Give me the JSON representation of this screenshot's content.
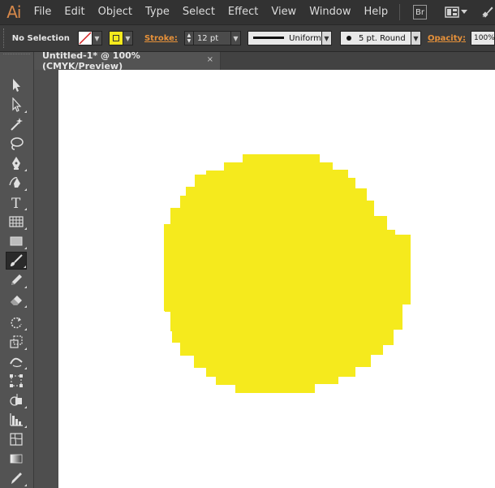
{
  "app": {
    "logo_text": "Ai",
    "menu": [
      "File",
      "Edit",
      "Object",
      "Type",
      "Select",
      "Effect",
      "View",
      "Window",
      "Help"
    ],
    "bridge_label": "Br"
  },
  "control_bar": {
    "selection_status": "No Selection",
    "stroke_label": "Stroke:",
    "stroke_weight": "12 pt",
    "stroke_profile": "Uniform",
    "brush_definition": "5 pt. Round",
    "opacity_label": "Opacity:",
    "opacity_value": "100%",
    "fill_color": "#ffffff",
    "stroke_color": "#f5ea1d"
  },
  "document": {
    "tab_title": "Untitled-1* @ 100% (CMYK/Preview)",
    "close_glyph": "×"
  },
  "artwork": {
    "shape": "pixelated circle brush stroke",
    "color": "#f5ea1d"
  },
  "tools": [
    {
      "name": "selection-tool",
      "icon": "arrow-icon"
    },
    {
      "name": "direct-selection-tool",
      "icon": "hollow-arrow-icon"
    },
    {
      "name": "magic-wand-tool",
      "icon": "magic-wand-icon"
    },
    {
      "name": "lasso-tool",
      "icon": "lasso-icon"
    },
    {
      "name": "pen-tool",
      "icon": "pen-icon"
    },
    {
      "name": "curvature-tool",
      "icon": "curvature-pen-icon"
    },
    {
      "name": "type-tool",
      "icon": "type-icon"
    },
    {
      "name": "line-tool",
      "icon": "grid-icon"
    },
    {
      "name": "rectangle-tool",
      "icon": "rectangle-icon"
    },
    {
      "name": "paintbrush-tool",
      "icon": "paintbrush-icon",
      "active": true
    },
    {
      "name": "pencil-tool",
      "icon": "pencil-icon"
    },
    {
      "name": "eraser-tool",
      "icon": "eraser-icon"
    },
    {
      "name": "rotate-tool",
      "icon": "rotate-icon"
    },
    {
      "name": "scale-tool",
      "icon": "scale-icon"
    },
    {
      "name": "width-tool",
      "icon": "width-icon"
    },
    {
      "name": "free-transform-tool",
      "icon": "free-transform-icon"
    },
    {
      "name": "shape-builder-tool",
      "icon": "shape-builder-icon"
    },
    {
      "name": "graph-tool",
      "icon": "bar-graph-icon"
    },
    {
      "name": "mesh-tool",
      "icon": "mesh-icon"
    },
    {
      "name": "gradient-tool",
      "icon": "gradient-icon"
    },
    {
      "name": "eyedropper-tool",
      "icon": "eyedropper-icon"
    }
  ]
}
